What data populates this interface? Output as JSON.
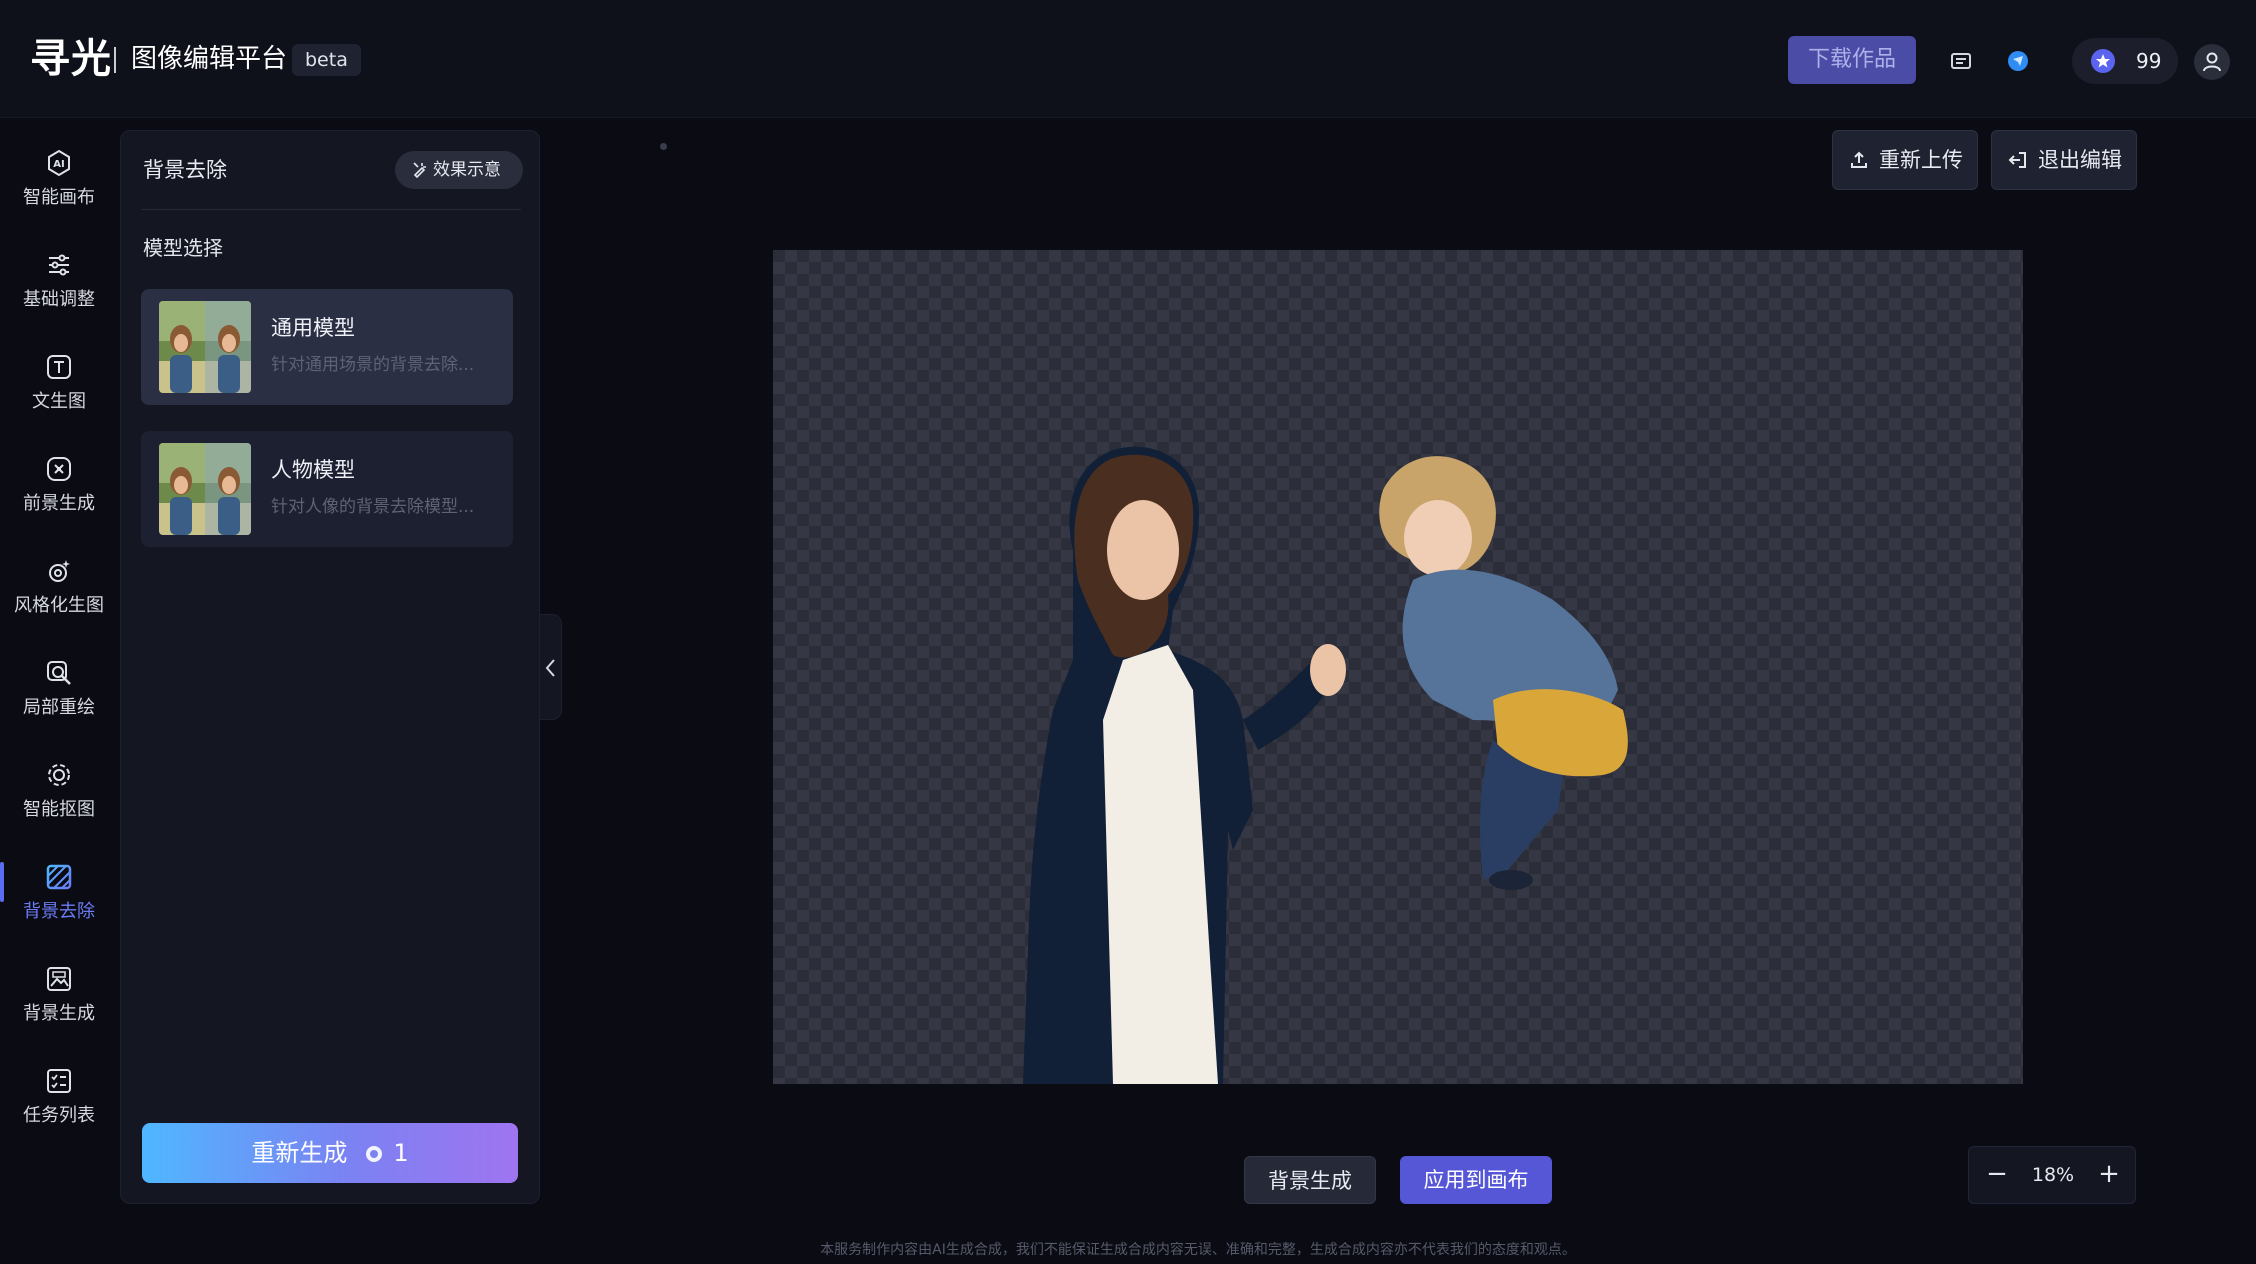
{
  "header": {
    "logo": "寻光",
    "platform_title": "图像编辑平台",
    "beta_label": "beta",
    "download_label": "下载作品",
    "credits": "99",
    "icons": [
      "message-icon",
      "discord-icon",
      "star-coin-icon",
      "user-icon"
    ]
  },
  "nav": {
    "items": [
      {
        "label": "智能画布",
        "icon": "ai-icon"
      },
      {
        "label": "基础调整",
        "icon": "sliders-icon"
      },
      {
        "label": "文生图",
        "icon": "text-icon"
      },
      {
        "label": "前景生成",
        "icon": "foreground-icon"
      },
      {
        "label": "风格化生图",
        "icon": "style-icon"
      },
      {
        "label": "局部重绘",
        "icon": "repaint-icon"
      },
      {
        "label": "智能抠图",
        "icon": "cutout-icon"
      },
      {
        "label": "背景去除",
        "icon": "bg-remove-icon",
        "active": true
      },
      {
        "label": "背景生成",
        "icon": "bg-generate-icon"
      },
      {
        "label": "任务列表",
        "icon": "task-list-icon"
      }
    ],
    "active_color": "#6b7cf5"
  },
  "panel": {
    "title": "背景去除",
    "example_label": "效果示意",
    "section_label": "模型选择",
    "models": [
      {
        "name": "通用模型",
        "desc": "针对通用场景的背景去除...",
        "selected": true
      },
      {
        "name": "人物模型",
        "desc": "针对人像的背景去除模型...",
        "selected": false
      }
    ],
    "regen_label": "重新生成",
    "regen_cost": "1"
  },
  "workspace": {
    "reupload_label": "重新上传",
    "exit_label": "退出编辑",
    "bg_generate_label": "背景生成",
    "apply_label": "应用到画布",
    "zoom": "18%",
    "zoom_minus": "−",
    "zoom_plus": "+"
  },
  "disclaimer": "本服务制作内容由AI生成合成，我们不能保证生成合成内容无误、准确和完整，生成合成内容亦不代表我们的态度和观点。",
  "colors": {
    "accent": "#4b4ca6",
    "apply_button": "#5557d6",
    "regen_gradient": [
      "#4fb7ff",
      "#9f74f0"
    ]
  }
}
